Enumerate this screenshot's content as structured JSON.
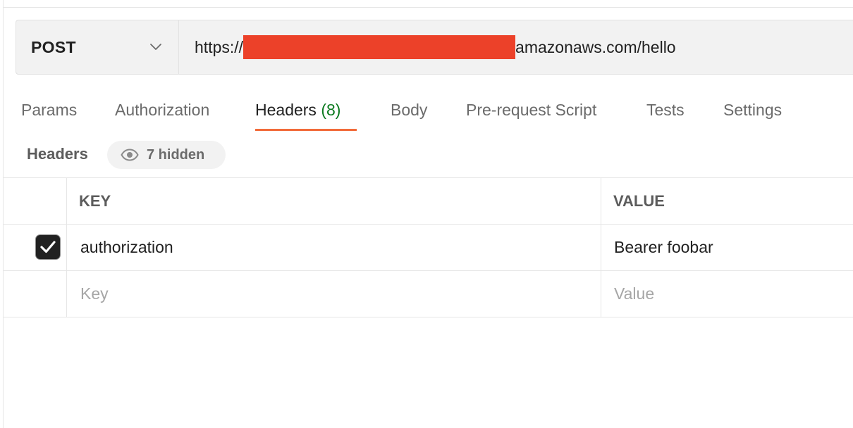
{
  "request": {
    "method": "POST",
    "url_prefix": "https://",
    "url_suffix": "amazonaws.com/hello"
  },
  "tabs": [
    {
      "label": "Params"
    },
    {
      "label": "Authorization"
    },
    {
      "label": "Headers",
      "count": "(8)"
    },
    {
      "label": "Body"
    },
    {
      "label": "Pre-request Script"
    },
    {
      "label": "Tests"
    },
    {
      "label": "Settings"
    }
  ],
  "headers_section": {
    "title": "Headers",
    "hidden_label": "7 hidden"
  },
  "table": {
    "columns": {
      "key": "KEY",
      "value": "VALUE"
    },
    "rows": [
      {
        "key": "authorization",
        "value": "Bearer foobar",
        "checked": true
      }
    ],
    "placeholders": {
      "key": "Key",
      "value": "Value"
    }
  },
  "colors": {
    "accent": "#f26b3a",
    "count_green": "#0b7a1f",
    "redaction": "#ec4129"
  },
  "icons": {
    "method_dropdown": "chevron-down-icon",
    "hidden_toggle": "eye-icon",
    "checkbox": "check-icon"
  }
}
